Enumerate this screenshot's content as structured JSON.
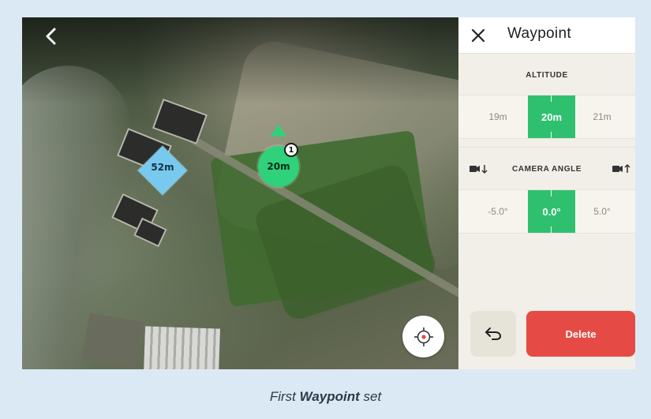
{
  "map": {
    "back_icon": "chevron-left-icon",
    "locate_icon": "crosshair-target-icon",
    "waypoints": [
      {
        "shape": "diamond",
        "label": "52m",
        "color": "#78c9ee"
      },
      {
        "shape": "circle",
        "label": "20m",
        "index": "1",
        "color": "#2fd17a"
      }
    ]
  },
  "panel": {
    "close_icon": "close-icon",
    "title": "Waypoint",
    "altitude": {
      "label": "ALTITUDE",
      "options": [
        "19m",
        "20m",
        "21m"
      ],
      "selected": "20m"
    },
    "camera_angle": {
      "label": "CAMERA ANGLE",
      "icon_left": "camera-tilt-down-icon",
      "icon_right": "camera-tilt-up-icon",
      "options": [
        "-5.0°",
        "0.0°",
        "5.0°"
      ],
      "selected": "0.0°"
    },
    "undo_icon": "undo-icon",
    "delete_label": "Delete"
  },
  "caption": {
    "prefix": "First ",
    "bold": "Waypoint",
    "suffix": " set"
  },
  "colors": {
    "accent_green": "#2fc06f",
    "delete_red": "#e54b44",
    "frame_bg": "#dbe9f4"
  }
}
